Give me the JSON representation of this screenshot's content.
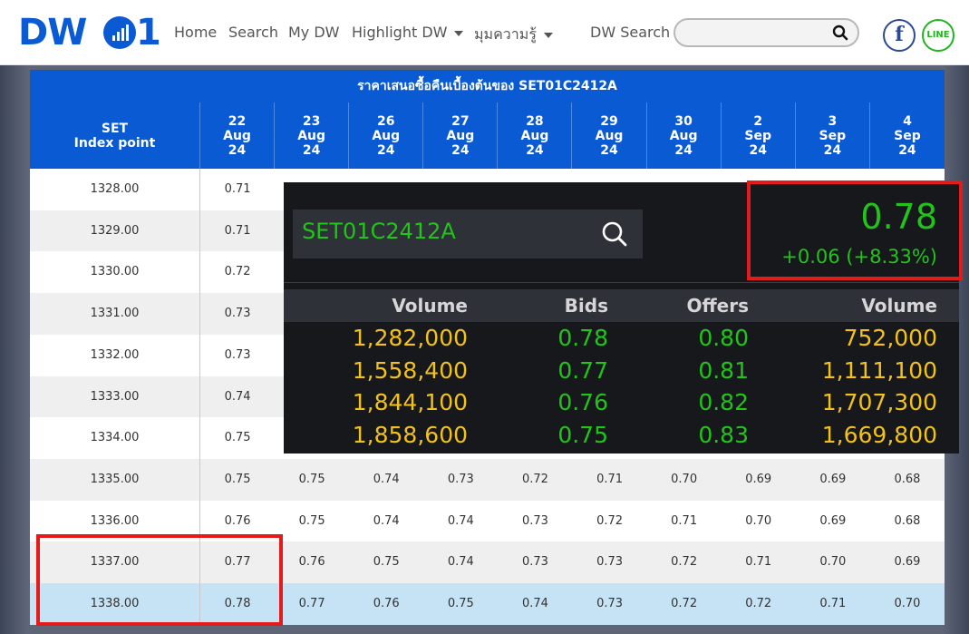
{
  "nav": {
    "logo": "DW01",
    "menu": [
      {
        "label": "Home",
        "dropdown": false
      },
      {
        "label": "Search",
        "dropdown": false
      },
      {
        "label": "My DW",
        "dropdown": false
      },
      {
        "label": "Highlight DW",
        "dropdown": true
      },
      {
        "label": "มุมความรู้",
        "dropdown": true
      }
    ],
    "search_label": "DW Search",
    "search_value": "",
    "facebook": "f",
    "line": "LINE"
  },
  "table": {
    "title": "ราคาเสนอซื้อคืนเบื้องต้นของ SET01C2412A",
    "first_header": [
      "SET",
      "Index point"
    ],
    "dates": [
      [
        "22",
        "Aug",
        "24"
      ],
      [
        "23",
        "Aug",
        "24"
      ],
      [
        "26",
        "Aug",
        "24"
      ],
      [
        "27",
        "Aug",
        "24"
      ],
      [
        "28",
        "Aug",
        "24"
      ],
      [
        "29",
        "Aug",
        "24"
      ],
      [
        "30",
        "Aug",
        "24"
      ],
      [
        "2",
        "Sep",
        "24"
      ],
      [
        "3",
        "Sep",
        "24"
      ],
      [
        "4",
        "Sep",
        "24"
      ]
    ],
    "rows": [
      {
        "index": "1328.00",
        "values": [
          "0.71"
        ]
      },
      {
        "index": "1329.00",
        "values": [
          "0.71"
        ]
      },
      {
        "index": "1330.00",
        "values": [
          "0.72"
        ]
      },
      {
        "index": "1331.00",
        "values": [
          "0.73"
        ]
      },
      {
        "index": "1332.00",
        "values": [
          "0.73"
        ]
      },
      {
        "index": "1333.00",
        "values": [
          "0.74"
        ]
      },
      {
        "index": "1334.00",
        "values": [
          "0.75"
        ]
      },
      {
        "index": "1335.00",
        "values": [
          "0.75",
          "0.75",
          "0.74",
          "0.73",
          "0.72",
          "0.71",
          "0.70",
          "0.69",
          "0.69",
          "0.68"
        ]
      },
      {
        "index": "1336.00",
        "values": [
          "0.76",
          "0.75",
          "0.74",
          "0.74",
          "0.73",
          "0.72",
          "0.71",
          "0.70",
          "0.69",
          "0.68"
        ]
      },
      {
        "index": "1337.00",
        "values": [
          "0.77",
          "0.76",
          "0.75",
          "0.74",
          "0.73",
          "0.73",
          "0.72",
          "0.71",
          "0.70",
          "0.69"
        ]
      },
      {
        "index": "1338.00",
        "values": [
          "0.78",
          "0.77",
          "0.76",
          "0.75",
          "0.74",
          "0.73",
          "0.72",
          "0.72",
          "0.71",
          "0.70"
        ],
        "highlighted": true
      }
    ]
  },
  "quote": {
    "symbol": "SET01C2412A",
    "price": "0.78",
    "change": "+0.06 (+8.33%)",
    "headers": [
      "Volume",
      "Bids",
      "Offers",
      "Volume"
    ],
    "book": [
      {
        "bid_vol": "1,282,000",
        "bid": "0.78",
        "offer": "0.80",
        "offer_vol": "752,000"
      },
      {
        "bid_vol": "1,558,400",
        "bid": "0.77",
        "offer": "0.81",
        "offer_vol": "1,111,100"
      },
      {
        "bid_vol": "1,844,100",
        "bid": "0.76",
        "offer": "0.82",
        "offer_vol": "1,707,300"
      },
      {
        "bid_vol": "1,858,600",
        "bid": "0.75",
        "offer": "0.83",
        "offer_vol": "1,669,800"
      }
    ]
  },
  "colors": {
    "brand_blue": "#0a5bd3",
    "up_green": "#21c419",
    "volume_yellow": "#f2c21b",
    "highlight_red": "#e31b1b"
  }
}
